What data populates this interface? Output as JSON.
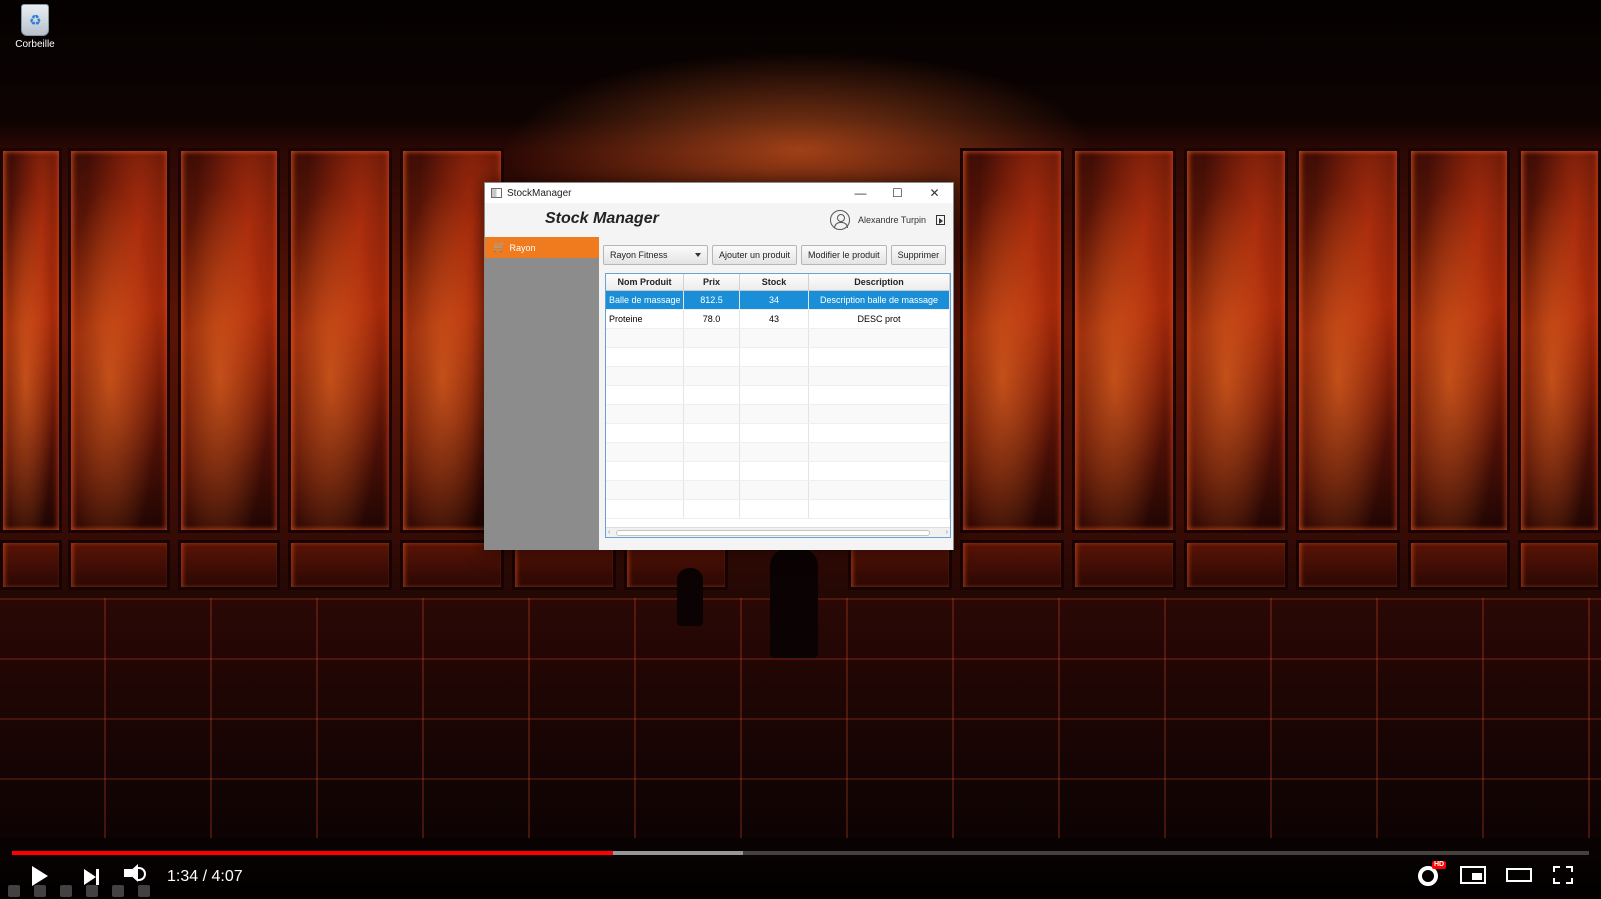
{
  "desktop": {
    "icon_label": "Corbeille"
  },
  "window": {
    "title": "StockManager",
    "controls": {
      "minimize": "—",
      "maximize": "☐",
      "close": "✕"
    }
  },
  "app": {
    "title": "Stock Manager",
    "user_name": "Alexandre Turpin"
  },
  "sidebar": {
    "items": [
      {
        "label": "Rayon",
        "icon": "cart-icon",
        "active": true
      }
    ],
    "active_color": "#f07a1e"
  },
  "toolbar": {
    "rayon_select": "Rayon Fitness",
    "add_label": "Ajouter un produit",
    "edit_label": "Modifier le produit",
    "delete_label": "Supprimer"
  },
  "table": {
    "columns": [
      "Nom Produit",
      "Prix",
      "Stock",
      "Description"
    ],
    "rows": [
      {
        "name": "Balle de massage",
        "price": "812.5",
        "stock": "34",
        "description": "Description balle de massage",
        "selected": true
      },
      {
        "name": "Proteine",
        "price": "78.0",
        "stock": "43",
        "description": "DESC prot",
        "selected": false
      }
    ],
    "selection_color": "#1a8fd8"
  },
  "player": {
    "time": "1:34 / 4:07",
    "progress_played_fraction": 0.381,
    "progress_buffered_fraction": 0.4636,
    "quality_badge": "HD",
    "progress_color": "#ff0000"
  }
}
